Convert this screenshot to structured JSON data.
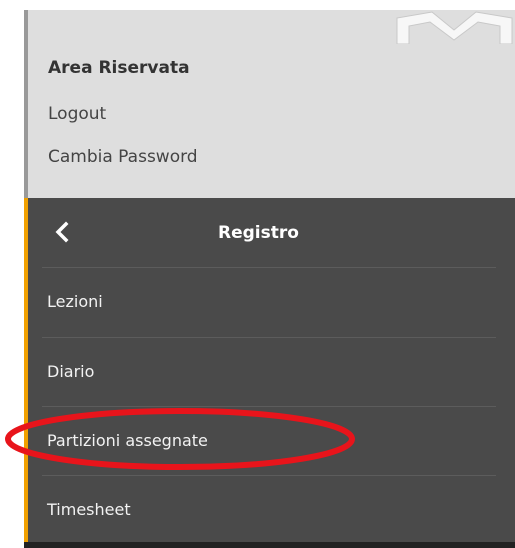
{
  "area": {
    "title": "Area Riservata",
    "logout_label": "Logout",
    "change_password_label": "Cambia Password"
  },
  "menu": {
    "title": "Registro",
    "back_icon": "chevron-left-icon",
    "items": [
      {
        "label": "Lezioni"
      },
      {
        "label": "Diario"
      },
      {
        "label": "Partizioni assegnate"
      },
      {
        "label": "Timesheet"
      }
    ]
  },
  "colors": {
    "top_background": "#dedede",
    "menu_background": "#4a4a4a",
    "accent": "#f0a000",
    "annotation": "#e8141b"
  }
}
